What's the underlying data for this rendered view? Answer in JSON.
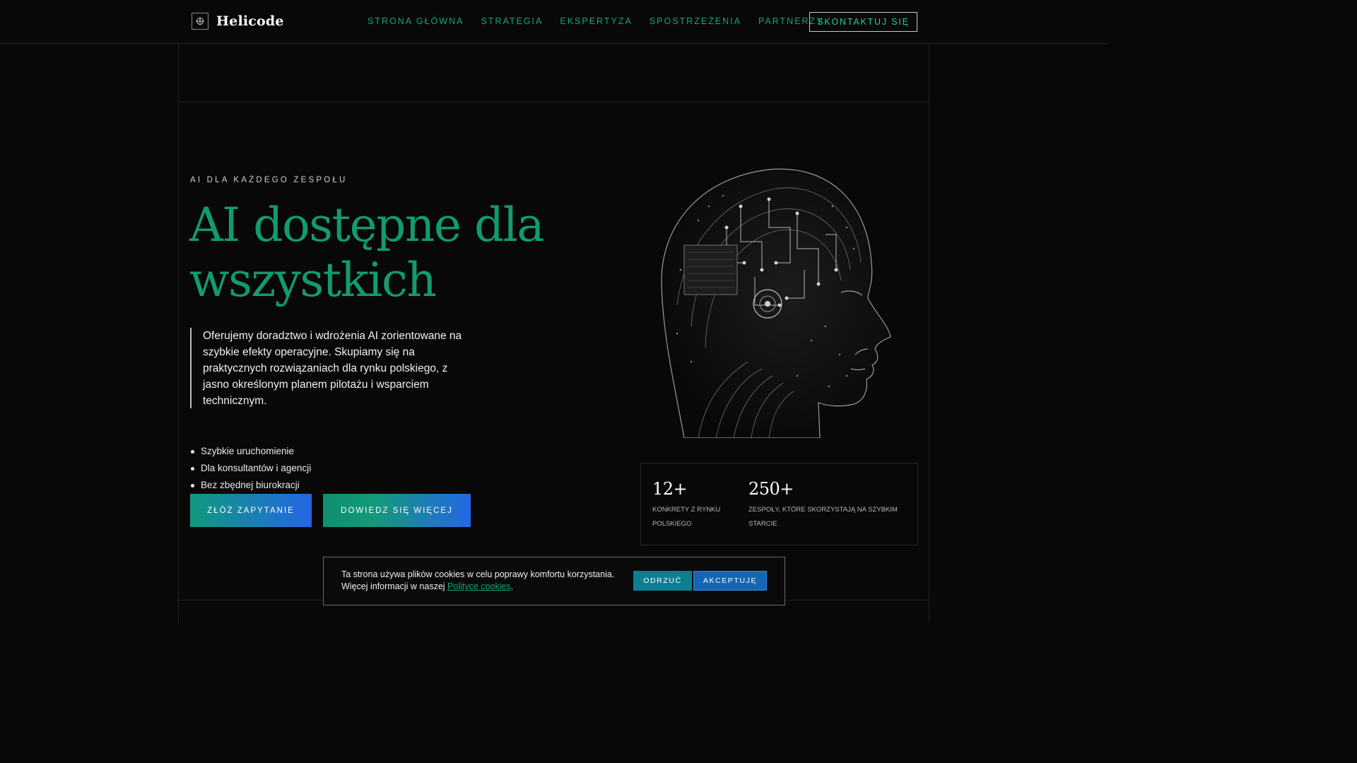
{
  "header": {
    "logo_text": "Helicode",
    "nav": [
      "STRONA GŁÓWNA",
      "STRATEGIA",
      "EKSPERTYZA",
      "SPOSTRZEŻENIA",
      "PARTNERZY"
    ],
    "contact_label": "SKONTAKTUJ SIĘ"
  },
  "hero": {
    "eyebrow": "AI DLA KAŻDEGO ZESPOŁU",
    "title": "AI dostępne dla wszystkich",
    "description": "Oferujemy doradztwo i wdrożenia AI zorientowane na szybkie efekty operacyjne. Skupiamy się na praktycznych rozwiązaniach dla rynku polskiego, z jasno określonym planem pilotażu i wsparciem technicznym.",
    "bullets": [
      "Szybkie uruchomienie",
      "Dla konsultantów i agencji",
      "Bez zbędnej biurokracji"
    ],
    "cta_primary": "ZŁÓŻ ZAPYTANIE",
    "cta_secondary": "DOWIEDZ SIĘ WIĘCEJ"
  },
  "stats": [
    {
      "value": "12+",
      "label": "KONKRETY Z RYNKU POLSKIEGO"
    },
    {
      "value": "250+",
      "label": "ZESPOŁY, KTÓRE SKORZYSTAJĄ NA SZYBKIM STARCIE"
    }
  ],
  "cookie": {
    "text_line1": "Ta strona używa plików cookies w celu poprawy komfortu korzystania.",
    "text_line2_prefix": "Więcej informacji w naszej ",
    "link_text": "Polityce cookies",
    "text_suffix": ".",
    "reject_label": "ODRZUĆ",
    "accept_label": "AKCEPTUJĘ"
  },
  "colors": {
    "accent_green": "#129b6e",
    "nav_green": "#13a57c",
    "gradient_start": "#0f9a7c",
    "gradient_end": "#2466e6",
    "background": "#080808"
  },
  "icons": {
    "logo_mark": "crosshair-icon"
  }
}
